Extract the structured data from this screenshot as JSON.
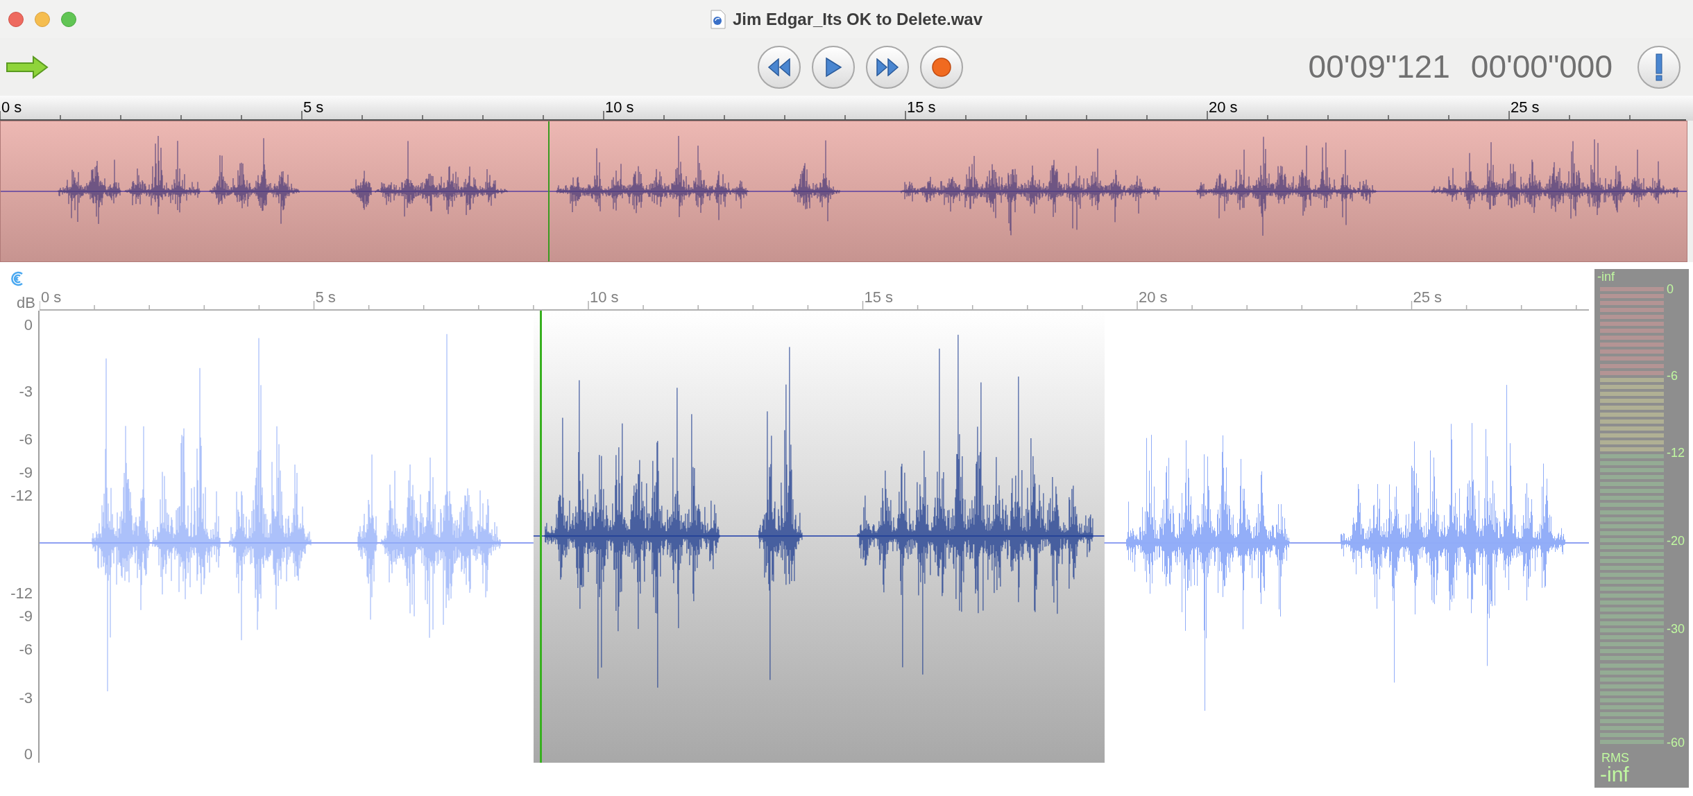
{
  "window": {
    "title": "Jim Edgar_Its OK to Delete.wav"
  },
  "transport": {
    "buttons": [
      {
        "kind": "rewind"
      },
      {
        "kind": "play"
      },
      {
        "kind": "fast_forward"
      },
      {
        "kind": "record"
      }
    ]
  },
  "time_readouts": [
    "00'09\"121",
    "00'00\"000"
  ],
  "overview": {
    "ruler_labels": [
      "0 s",
      "5 s",
      "10 s",
      "15 s",
      "20 s",
      "25 s"
    ]
  },
  "editor": {
    "ruler_labels": [
      "0 s",
      "5 s",
      "10 s",
      "15 s",
      "20 s",
      "25 s"
    ],
    "db_label": "dB",
    "db_ticks": [
      "0",
      "-3",
      "-6",
      "-9",
      "-12",
      "-12",
      "-9",
      "-6",
      "-3",
      "0"
    ]
  },
  "meter": {
    "peak": "-inf",
    "scale": [
      "0",
      "-6",
      "-12",
      "-20",
      "-30",
      "-60"
    ],
    "rms_label": "RMS",
    "rms": "-inf"
  }
}
